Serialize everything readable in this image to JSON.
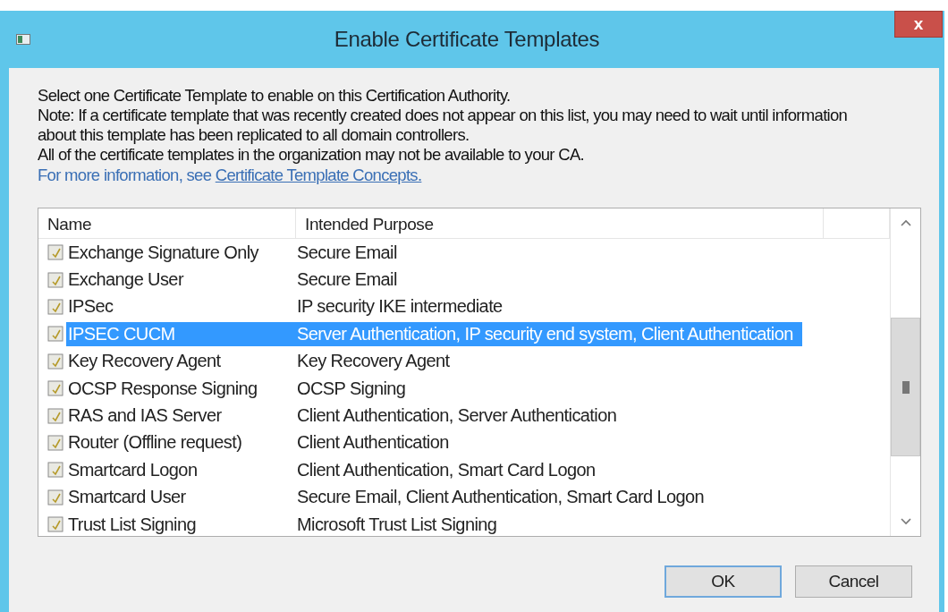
{
  "window": {
    "title": "Enable Certificate Templates",
    "close": "x"
  },
  "intro": [
    "Select one Certificate Template to enable on this Certification Authority.",
    "Note: If a certificate template that was recently created does not appear on this list, you may need to wait until information about this template has been replicated to all domain controllers.",
    "All of the certificate templates in the organization may not be available to your CA."
  ],
  "more_info": {
    "text": "For more information, see",
    "link": "Certificate Template Concepts."
  },
  "table": {
    "columns": [
      "Name",
      "Intended Purpose"
    ],
    "rows": [
      {
        "name": "Exchange Signature Only",
        "purpose": "Secure Email",
        "selected": false
      },
      {
        "name": "Exchange User",
        "purpose": "Secure Email",
        "selected": false
      },
      {
        "name": "IPSec",
        "purpose": "IP security IKE intermediate",
        "selected": false
      },
      {
        "name": "IPSEC CUCM",
        "purpose": "Server Authentication, IP security end system, Client Authentication",
        "selected": true
      },
      {
        "name": "Key Recovery Agent",
        "purpose": "Key Recovery Agent",
        "selected": false
      },
      {
        "name": "OCSP Response Signing",
        "purpose": "OCSP Signing",
        "selected": false
      },
      {
        "name": "RAS and IAS Server",
        "purpose": "Client Authentication, Server Authentication",
        "selected": false
      },
      {
        "name": "Router (Offline request)",
        "purpose": "Client Authentication",
        "selected": false
      },
      {
        "name": "Smartcard Logon",
        "purpose": "Client Authentication, Smart Card Logon",
        "selected": false
      },
      {
        "name": "Smartcard User",
        "purpose": "Secure Email, Client Authentication, Smart Card Logon",
        "selected": false
      },
      {
        "name": "Trust List Signing",
        "purpose": "Microsoft Trust List Signing",
        "selected": false
      }
    ]
  },
  "buttons": [
    "OK",
    "Cancel"
  ]
}
